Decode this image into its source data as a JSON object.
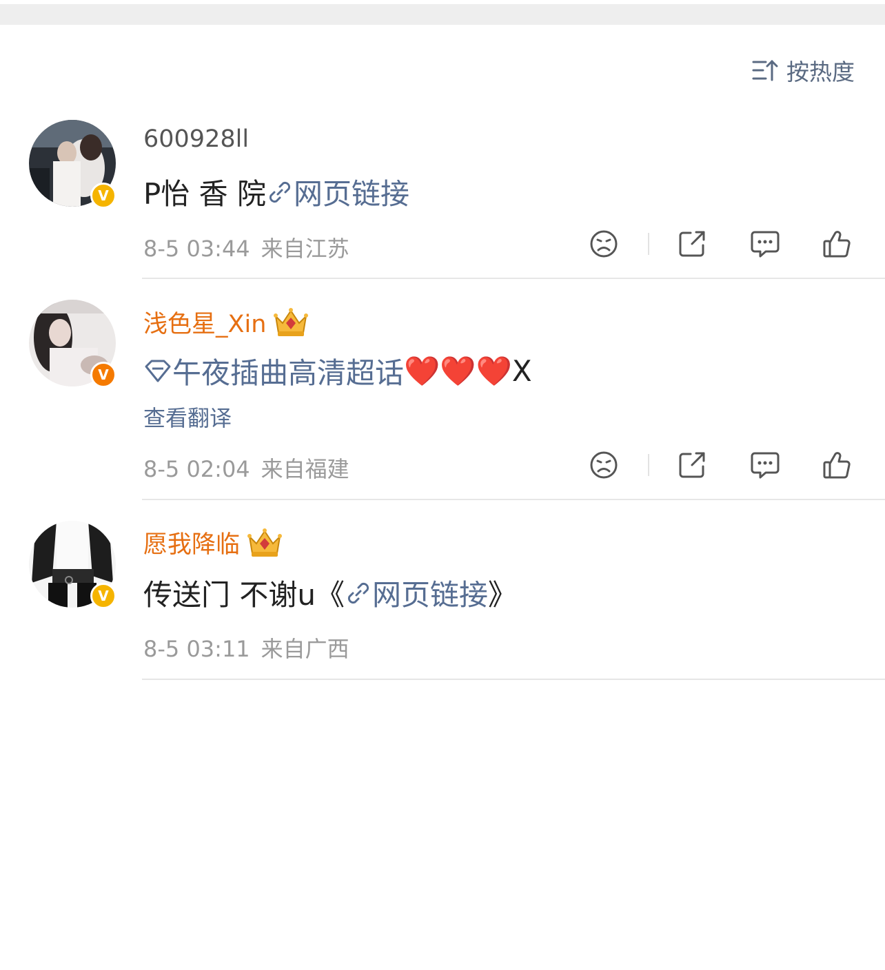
{
  "sort": {
    "label": "按热度",
    "icon": "sort-arrow-icon"
  },
  "comments": [
    {
      "username": "600928ll",
      "verified_badge": "V",
      "text_prefix": "P怡 香 院 ",
      "link_text": "网页链接",
      "text_suffix": "",
      "time": "8-5 03:44",
      "location": "来自江苏"
    },
    {
      "username": "浅色星_Xin",
      "verified_badge": "V",
      "supertopic_text": "午夜插曲高清超话",
      "hearts": "❤️❤️❤️",
      "text_suffix": "X",
      "translate": "查看翻译",
      "time": "8-5 02:04",
      "location": "来自福建"
    },
    {
      "username": "愿我降临",
      "verified_badge": "V",
      "text_prefix": "传送门 不谢u《",
      "link_text": "网页链接",
      "text_suffix": "》",
      "time": "8-5 03:11",
      "location": "来自广西"
    }
  ],
  "colors": {
    "link": "#566d92",
    "vip_name": "#e66f12",
    "meta": "#9a9a9a",
    "badge_yellow": "#f5b400",
    "badge_orange": "#f57a00"
  }
}
